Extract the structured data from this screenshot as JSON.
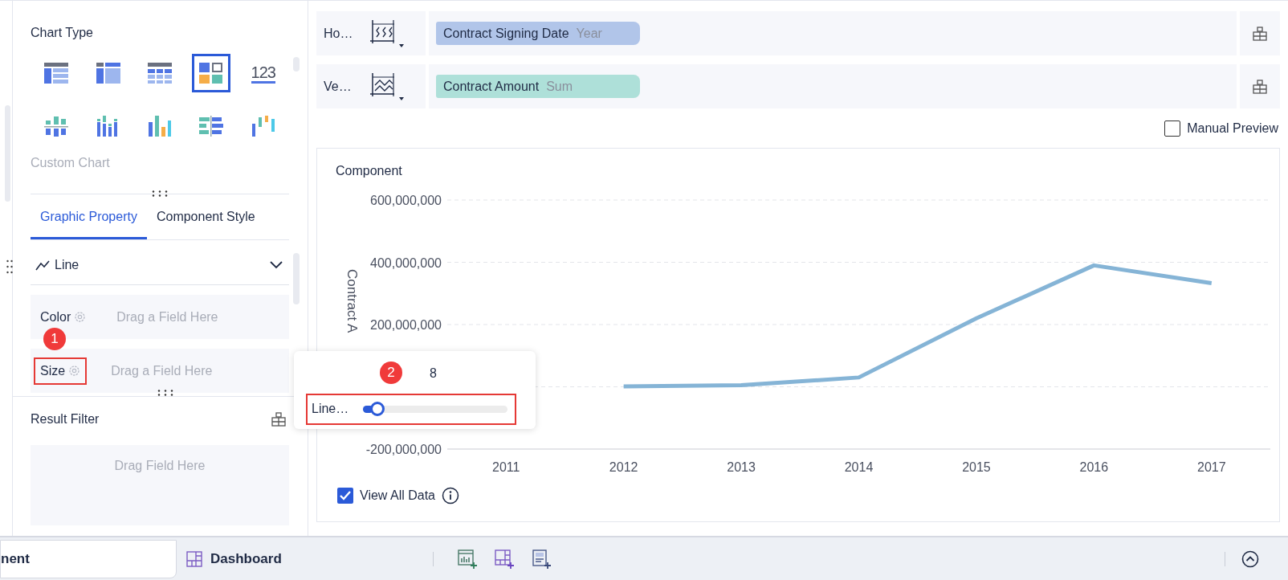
{
  "chart_type": {
    "title": "Chart Type",
    "types": [
      {
        "kind": "table",
        "selected": false
      },
      {
        "kind": "cross_table",
        "selected": false
      },
      {
        "kind": "detail_table",
        "selected": false
      },
      {
        "kind": "multi",
        "selected": true
      },
      {
        "kind": "number",
        "glyph": "123",
        "selected": false
      },
      {
        "kind": "split_bar",
        "selected": false
      },
      {
        "kind": "grouped_bar",
        "selected": false
      },
      {
        "kind": "bar",
        "selected": false
      },
      {
        "kind": "comparison_bar",
        "selected": false
      },
      {
        "kind": "waterfall",
        "selected": false
      }
    ],
    "custom_chart": "Custom Chart"
  },
  "tabs": [
    {
      "label": "Graphic Property",
      "selected": true
    },
    {
      "label": "Component Style",
      "selected": false
    }
  ],
  "mark_type": {
    "label": "Line"
  },
  "mark_fields": [
    {
      "label": "Color",
      "placeholder": "Drag a Field Here",
      "highlighted": false
    },
    {
      "label": "Size",
      "placeholder": "Drag a Field Here",
      "highlighted": true,
      "badge": "1"
    }
  ],
  "result_filter": {
    "title": "Result Filter",
    "placeholder": "Drag Field Here"
  },
  "axes": [
    {
      "label": "Ho…",
      "kind": "horizontal",
      "field": "Contract Signing Date",
      "aggregation": "Year",
      "color": "#b1c5e9"
    },
    {
      "label": "Ve…",
      "kind": "vertical",
      "field": "Contract Amount",
      "aggregation": "Sum",
      "color": "#aee0d9"
    }
  ],
  "manual_preview": {
    "label": "Manual Preview",
    "checked": false
  },
  "chart": {
    "title": "Component",
    "chart_data": {
      "type": "line",
      "ylabel": "Contract A",
      "categories": [
        "2011",
        "2012",
        "2013",
        "2014",
        "2015",
        "2016",
        "2017"
      ],
      "series": [
        {
          "color": "#85b4d6",
          "values": [
            null,
            1000000,
            5000000,
            30000000,
            220000000,
            390000000,
            333000000
          ]
        }
      ],
      "ylim": [
        -200000000,
        600000000
      ],
      "yticks": [
        {
          "value": 600000000,
          "label": "600,000,000"
        },
        {
          "value": 400000000,
          "label": "400,000,000"
        },
        {
          "value": 200000000,
          "label": "200,000,000"
        },
        {
          "value": -200000000,
          "label": "-200,000,000"
        }
      ]
    }
  },
  "view_all_data": {
    "label": "View All Data",
    "checked": true
  },
  "size_popup": {
    "badge": "2",
    "value": "8",
    "label": "Line…",
    "level": 0.07
  },
  "bottom_tabs": [
    {
      "label": "nent",
      "selected": true
    },
    {
      "label": "Dashboard",
      "selected": false
    }
  ]
}
